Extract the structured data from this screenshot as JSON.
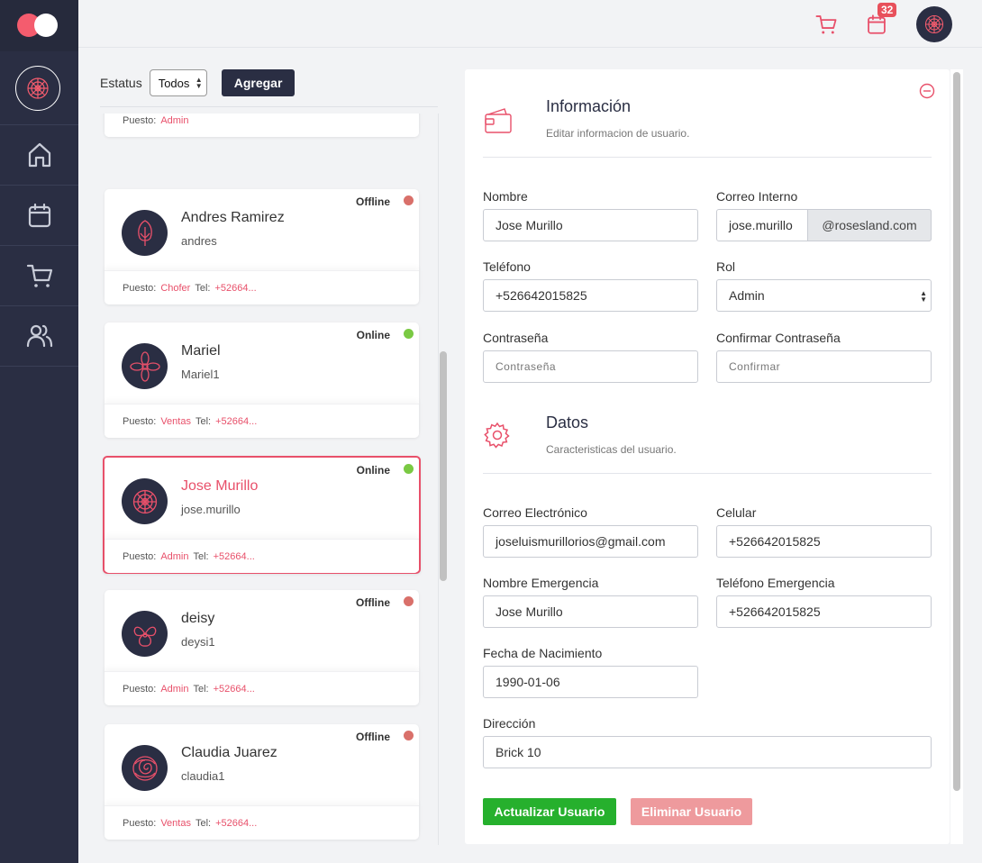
{
  "colors": {
    "sidebar": "#2a2e43",
    "accent": "#e8506a",
    "online": "#7ac943",
    "offline": "#d9706a",
    "save": "#26b02d",
    "delete": "#ee9a9d"
  },
  "topbar": {
    "cart_icon": "cart-icon",
    "calendar_icon": "calendar-icon",
    "calendar_badge": "32"
  },
  "sidebar": {
    "items": [
      "home-icon",
      "calendar-icon",
      "cart-icon",
      "users-icon"
    ]
  },
  "filter": {
    "label": "Estatus",
    "select_value": "Todos",
    "add_button": "Agregar"
  },
  "users": [
    {
      "name": "",
      "username": "",
      "status": "",
      "puesto": "Admin",
      "tel": ""
    },
    {
      "name": "Andres Ramirez",
      "username": "andres",
      "status": "Offline",
      "puesto": "Chofer",
      "tel": "+52664..."
    },
    {
      "name": "Mariel",
      "username": "Mariel1",
      "status": "Online",
      "puesto": "Ventas",
      "tel": "+52664..."
    },
    {
      "name": "Jose Murillo",
      "username": "jose.murillo",
      "status": "Online",
      "puesto": "Admin",
      "tel": "+52664..."
    },
    {
      "name": "deisy",
      "username": "deysi1",
      "status": "Offline",
      "puesto": "Admin",
      "tel": "+52664..."
    },
    {
      "name": "Claudia Juarez",
      "username": "claudia1",
      "status": "Offline",
      "puesto": "Ventas",
      "tel": "+52664..."
    }
  ],
  "labels": {
    "puesto": "Puesto:",
    "tel": "Tel:"
  },
  "info": {
    "title": "Información",
    "subtitle": "Editar informacion de usuario.",
    "nombre_label": "Nombre",
    "nombre_value": "Jose Murillo",
    "correo_label": "Correo Interno",
    "correo_value": "jose.murillo",
    "correo_domain": "@rosesland.com",
    "telefono_label": "Teléfono",
    "telefono_value": "+526642015825",
    "rol_label": "Rol",
    "rol_value": "Admin",
    "pass_label": "Contraseña",
    "pass_placeholder": "Contraseña",
    "confirm_label": "Confirmar Contraseña",
    "confirm_placeholder": "Confirmar"
  },
  "datos": {
    "title": "Datos",
    "subtitle": "Caracteristicas del usuario.",
    "email_label": "Correo Electrónico",
    "email_value": "joseluismurillorios@gmail.com",
    "celular_label": "Celular",
    "celular_value": "+526642015825",
    "emerg_name_label": "Nombre Emergencia",
    "emerg_name_value": "Jose Murillo",
    "emerg_tel_label": "Teléfono Emergencia",
    "emerg_tel_value": "+526642015825",
    "birth_label": "Fecha de Nacimiento",
    "birth_value": "1990-01-06",
    "address_label": "Dirección",
    "address_value": "Brick 10"
  },
  "actions": {
    "update": "Actualizar Usuario",
    "delete": "Eliminar Usuario"
  }
}
